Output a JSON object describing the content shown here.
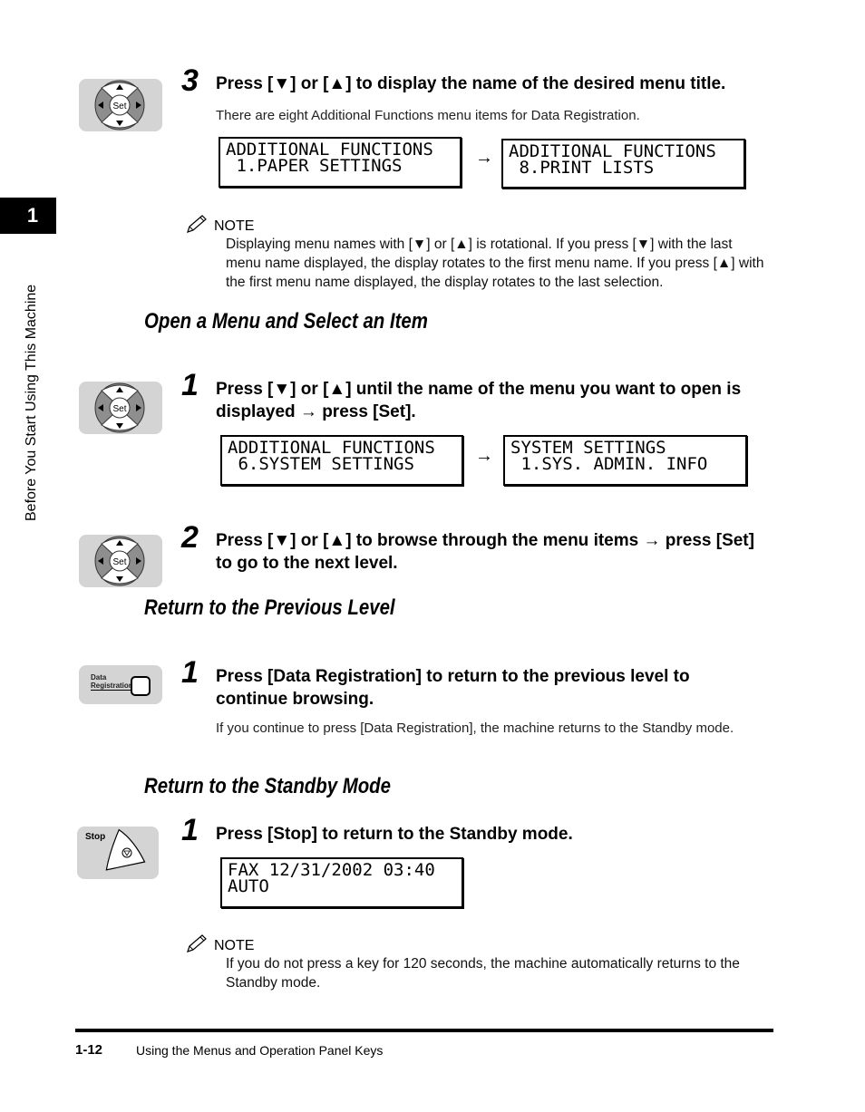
{
  "sidebar": {
    "chapter_number": "1",
    "chapter_title": "Before You Start Using This Machine"
  },
  "step3": {
    "key_icon": "set-key-icon",
    "number": "3",
    "title": "Press [▼] or [▲] to display the name of the desired menu title.",
    "description": "There are eight Additional Functions menu items for Data Registration.",
    "display_from": [
      "ADDITIONAL FUNCTIONS",
      " 1.PAPER SETTINGS"
    ],
    "arrow": "→",
    "display_to": [
      "ADDITIONAL FUNCTIONS",
      " 8.PRINT LISTS"
    ]
  },
  "note1": {
    "icon": "pencil-icon",
    "label": "NOTE",
    "text": "Displaying menu names with [▼] or [▲] is rotational. If you press [▼] with the last menu name displayed, the display rotates to the first menu name. If you press [▲] with the first menu name displayed, the display rotates to the last selection."
  },
  "section_open": {
    "heading": "Open a Menu and Select an Item",
    "step1": {
      "key_icon": "set-key-icon",
      "number": "1",
      "title": "Press [▼] or [▲] until the name of the menu you want to open is displayed → press [Set].",
      "display_from": [
        "ADDITIONAL FUNCTIONS",
        " 6.SYSTEM SETTINGS"
      ],
      "arrow": "→",
      "display_to": [
        "SYSTEM SETTINGS",
        " 1.SYS. ADMIN. INFO"
      ]
    },
    "step2": {
      "key_icon": "set-key-icon",
      "number": "2",
      "title": "Press [▼] or [▲] to browse through the menu items → press [Set] to go to the next level."
    }
  },
  "section_previous": {
    "heading": "Return to the Previous Level",
    "step1": {
      "key_icon": "data-registration-key-icon",
      "key_label_line1": "Data",
      "key_label_line2": "Registration",
      "number": "1",
      "title": "Press [Data Registration] to return to the previous level to continue browsing.",
      "description": "If you continue to press [Data Registration], the machine returns to the Standby mode."
    }
  },
  "section_standby": {
    "heading": "Return to the Standby Mode",
    "step1": {
      "key_icon": "stop-key-icon",
      "key_label": "Stop",
      "number": "1",
      "title": "Press [Stop] to return to the Standby mode.",
      "display": [
        "FAX 12/31/2002 03:40",
        "AUTO"
      ]
    }
  },
  "note2": {
    "icon": "pencil-icon",
    "label": "NOTE",
    "text": "If you do not press a key for 120 seconds, the machine automatically returns to the Standby mode."
  },
  "footer": {
    "page_number": "1-12",
    "section_title": "Using the Menus and Operation Panel Keys"
  }
}
